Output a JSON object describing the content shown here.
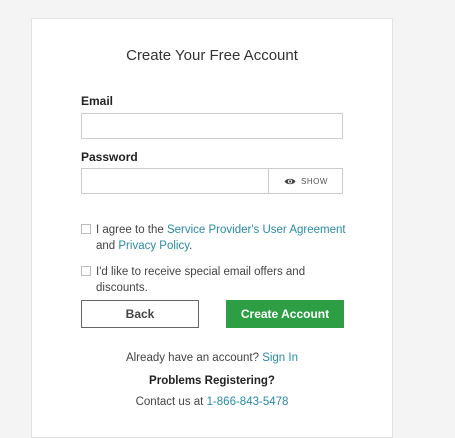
{
  "form": {
    "title": "Create Your Free Account",
    "email_label": "Email",
    "email_value": "",
    "password_label": "Password",
    "password_value": "",
    "show_label": "SHOW",
    "agreement": {
      "prefix": "I agree to the ",
      "user_agreement_link": "Service Provider's User Agreement",
      "middle": "and ",
      "privacy_link": "Privacy Policy",
      "suffix": ".",
      "checked": false
    },
    "offers": {
      "text": "I'd like to receive special email offers and discounts.",
      "checked": false
    },
    "back_label": "Back",
    "create_label": "Create Account",
    "signin_prefix": "Already have an account? ",
    "signin_link": "Sign In",
    "problems_label": "Problems Registering?",
    "contact_prefix": "Contact us at ",
    "contact_phone": "1-866-843-5478"
  },
  "colors": {
    "link": "#2a8aa6",
    "primary_button": "#2e9e44"
  },
  "icons": {
    "show_password": "eye-icon"
  }
}
